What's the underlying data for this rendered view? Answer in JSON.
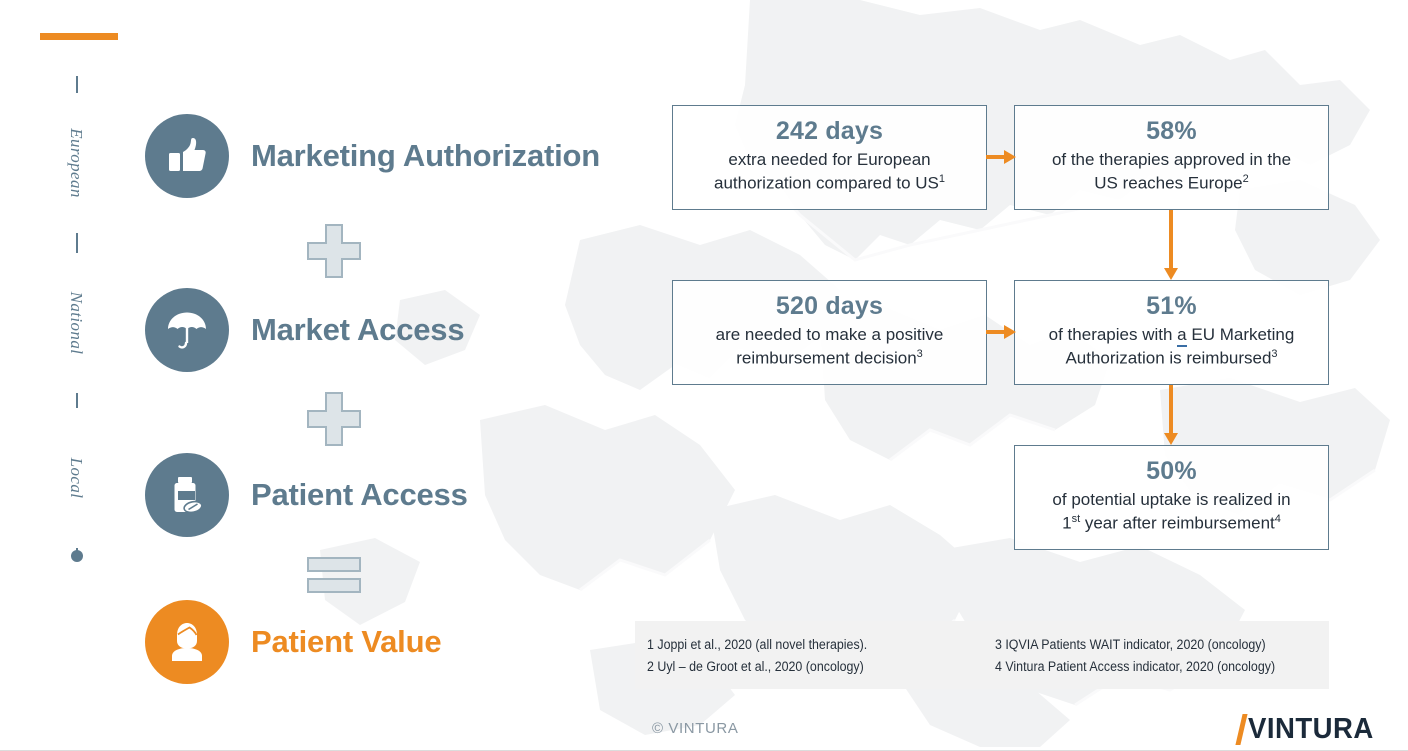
{
  "theme": {
    "accent_orange": "#ED8B22",
    "slate_blue": "#5E7B8E",
    "body_text": "#26303B",
    "footnote_bg": "#F2F2F2",
    "logo_navy": "#1B2A3A"
  },
  "scale": {
    "levels": [
      {
        "label": "European"
      },
      {
        "label": "National"
      },
      {
        "label": "Local"
      }
    ]
  },
  "stages": [
    {
      "label": "Marketing Authorization",
      "icon": "thumbs-up-icon",
      "accent": false
    },
    {
      "label": "Market Access",
      "icon": "umbrella-icon",
      "accent": false
    },
    {
      "label": "Patient Access",
      "icon": "pill-bottle-icon",
      "accent": false
    },
    {
      "label": "Patient Value",
      "icon": "patient-person-icon",
      "accent": true
    }
  ],
  "operators": [
    {
      "symbol": "plus",
      "name": "plus-operator"
    },
    {
      "symbol": "plus",
      "name": "plus-operator"
    },
    {
      "symbol": "equals",
      "name": "equals-operator"
    }
  ],
  "boxes": {
    "a": {
      "headline": "242 days",
      "line1": "extra needed for European",
      "line2": "authorization compared to US",
      "footnote_ref": "1"
    },
    "b": {
      "headline": "58%",
      "line1": "of the therapies approved in the",
      "line2": "US reaches Europe",
      "footnote_ref": "2"
    },
    "c": {
      "headline": "520 days",
      "line1": "are needed to make a positive",
      "line2": "reimbursement decision",
      "footnote_ref": "3"
    },
    "d": {
      "headline": "51%",
      "line1_pre": "of therapies with ",
      "line1_flagged": "a",
      "line1_post": " EU Marketing",
      "line2": "Authorization is reimbursed",
      "footnote_ref": "3"
    },
    "e": {
      "headline": "50%",
      "line1": "of potential uptake is realized in",
      "line2_pre": "1",
      "line2_ord": "st",
      "line2_post": " year after reimbursement",
      "footnote_ref": "4"
    }
  },
  "footnotes": {
    "left": [
      "1 Joppi et al., 2020 (all novel therapies).",
      "2 Uyl – de Groot et al., 2020 (oncology)"
    ],
    "right": [
      "3 IQVIA Patients WAIT indicator, 2020 (oncology)",
      "4 Vintura Patient Access indicator, 2020 (oncology)"
    ]
  },
  "footer": {
    "copyright": "© VINTURA",
    "logo_text": "VINTURA"
  }
}
